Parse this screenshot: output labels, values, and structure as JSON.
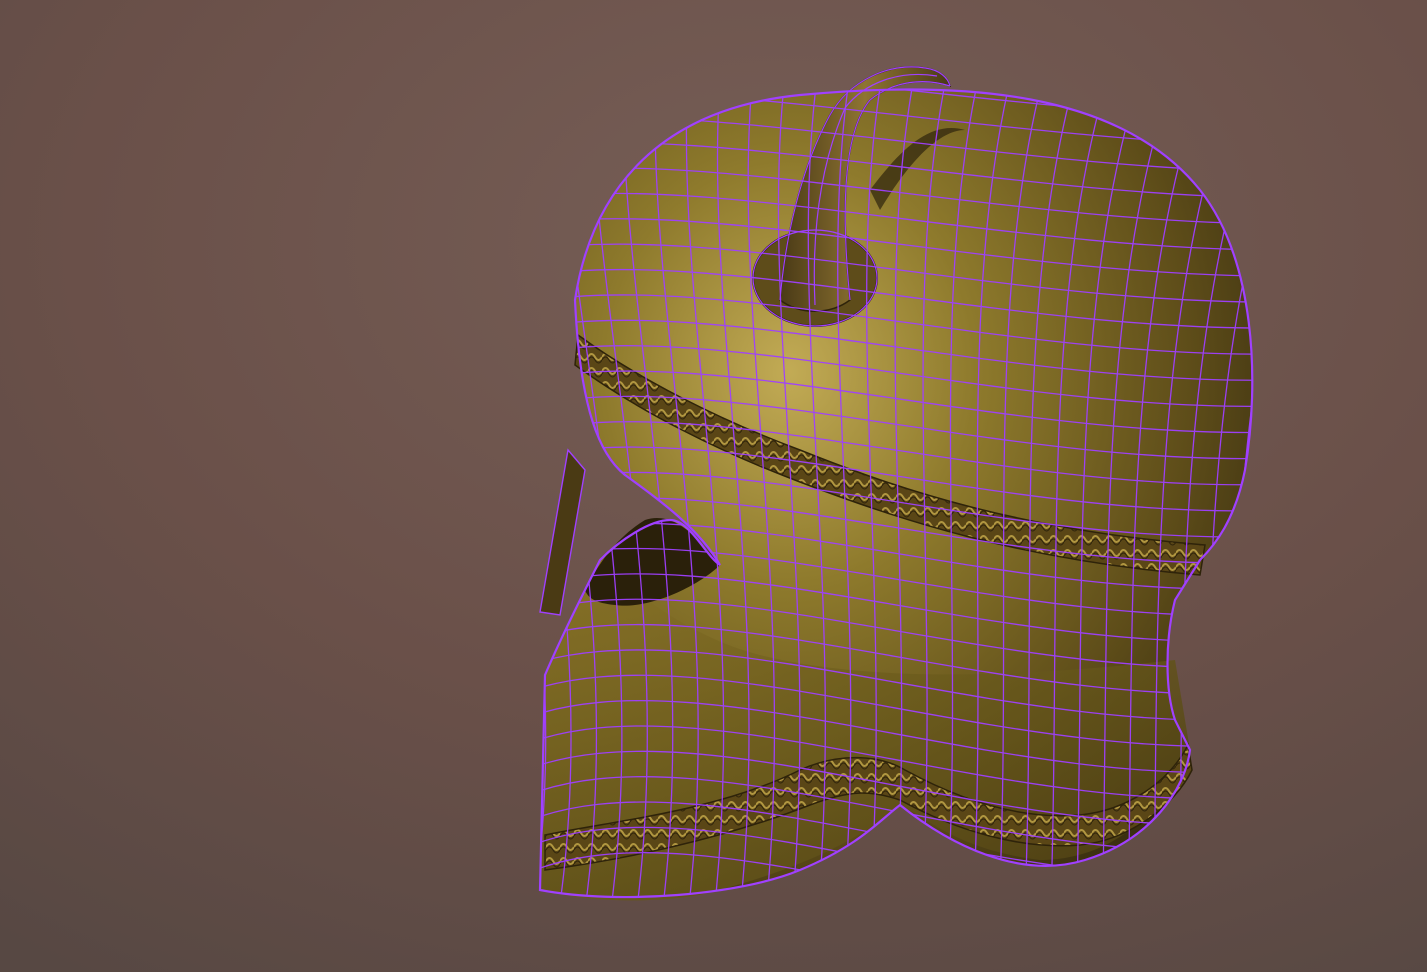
{
  "viewport": {
    "background_top": "#715a52",
    "background_mid": "#6a5048",
    "background_bottom": "#5a4a45"
  },
  "model": {
    "name": "helmet-model",
    "material_base": "#6e5a1e",
    "material_highlight": "#b9a048",
    "material_shadow": "#3a2e10",
    "band_color": "#4a3a14",
    "wireframe_color": "#a040ff",
    "horn_color": "#6a5420"
  },
  "wireframe": {
    "visible": true
  }
}
